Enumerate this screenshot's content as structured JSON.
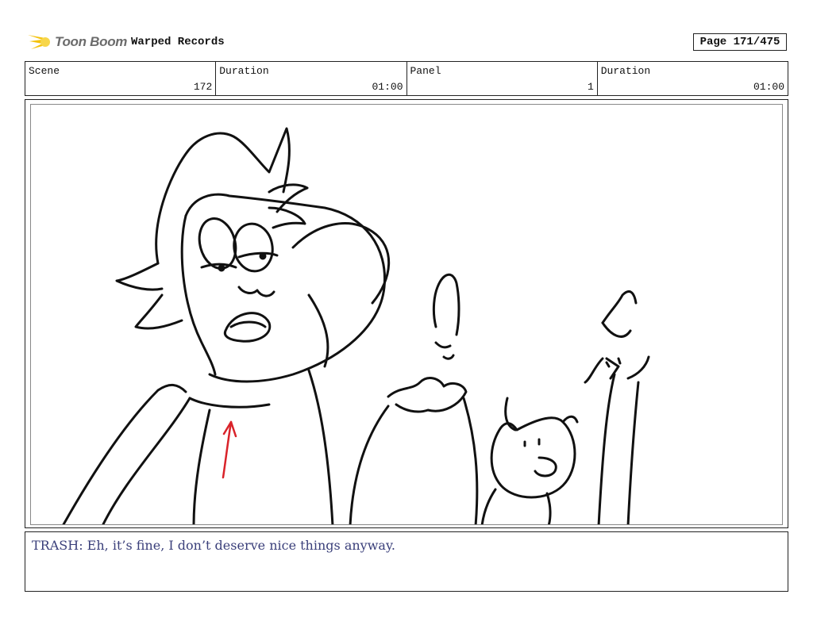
{
  "header": {
    "logo_text": "Toon Boom",
    "project_title": "Warped Records",
    "page_label": "Page 171/475"
  },
  "info": {
    "scene_label": "Scene",
    "scene_value": "172",
    "scene_duration_label": "Duration",
    "scene_duration_value": "01:00",
    "panel_label": "Panel",
    "panel_value": "1",
    "panel_duration_label": "Duration",
    "panel_duration_value": "01:00"
  },
  "dialogue": {
    "text": "TRASH: Eh, it’s fine, I don’t deserve nice things anyway."
  },
  "colors": {
    "logo_accent": "#f4c20d",
    "dialogue_text": "#3a3f7a",
    "arrow": "#d9232a"
  }
}
